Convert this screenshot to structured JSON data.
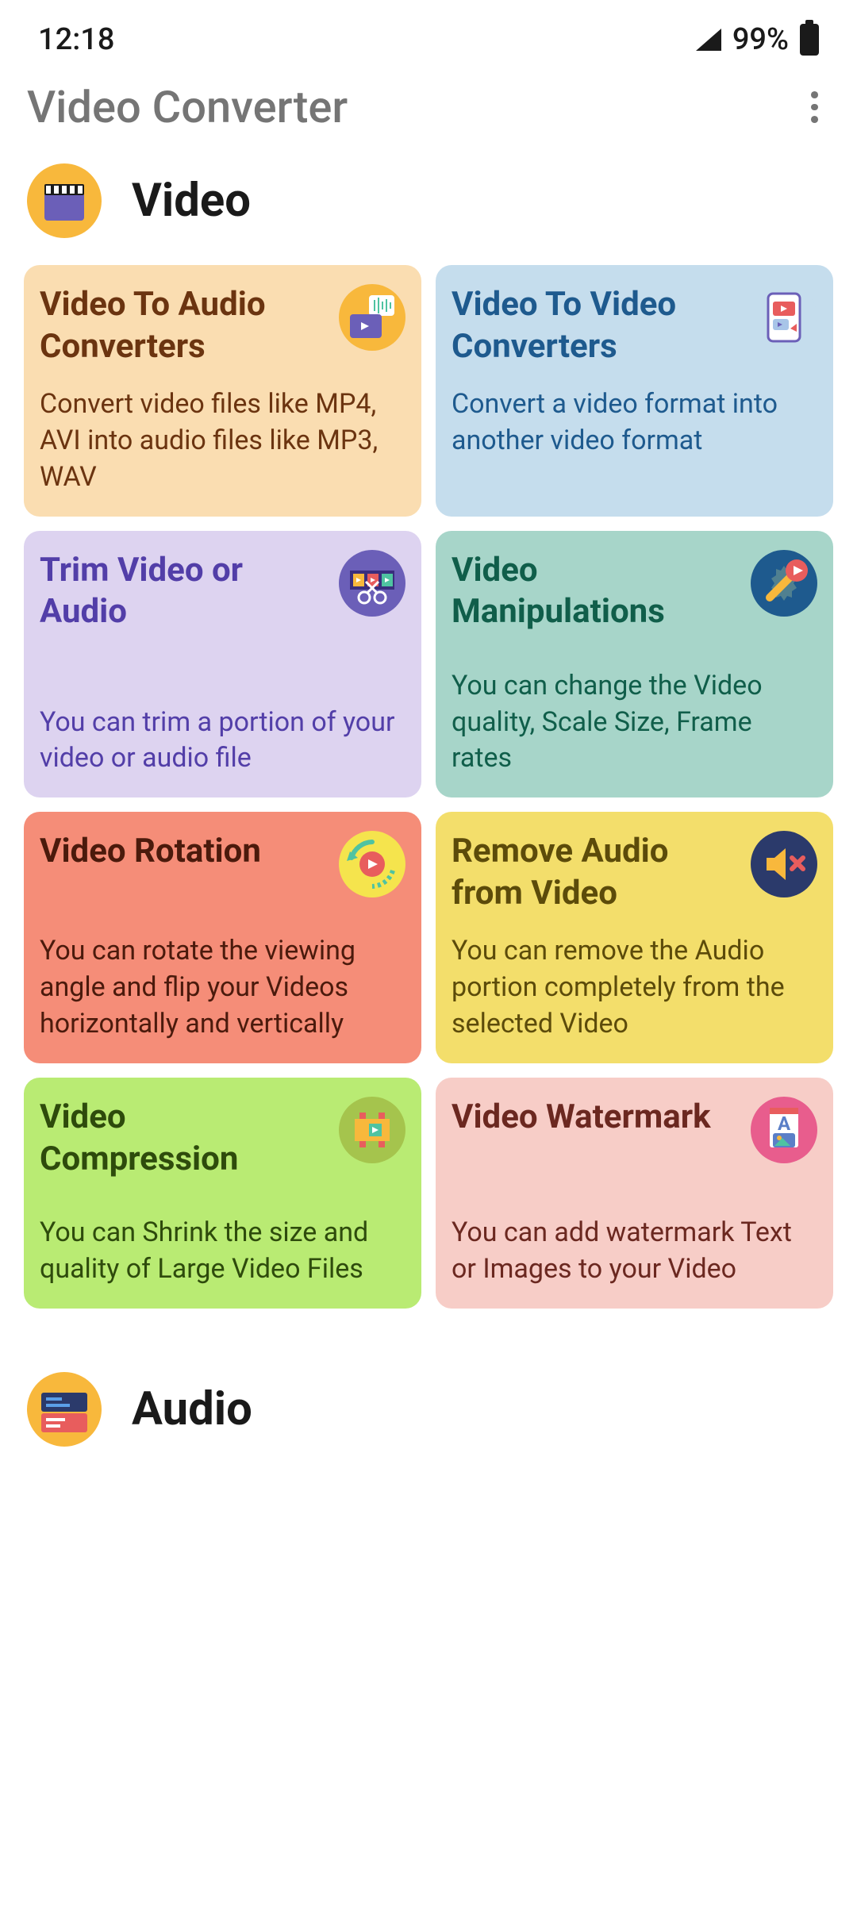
{
  "status": {
    "time": "12:18",
    "battery_pct": "99%"
  },
  "header": {
    "title": "Video Converter"
  },
  "sections": {
    "video": {
      "title": "Video"
    },
    "audio": {
      "title": "Audio"
    }
  },
  "cards": [
    {
      "title": "Video To Audio Converters",
      "desc": "Convert video files like MP4, AVI into audio files like MP3, WAV",
      "icon": "video-to-audio-icon",
      "color": "orange"
    },
    {
      "title": "Video To Video Converters",
      "desc": "Convert a video format into another video format",
      "icon": "video-to-video-icon",
      "color": "blue"
    },
    {
      "title": "Trim Video or Audio",
      "desc": "You can trim a portion of your video or audio file",
      "icon": "trim-icon",
      "color": "purple"
    },
    {
      "title": "Video Manipulations",
      "desc": "You can change the Video quality, Scale Size, Frame rates",
      "icon": "manipulation-icon",
      "color": "teal"
    },
    {
      "title": "Video Rotation",
      "desc": "You can rotate the viewing angle and flip your Videos horizontally and vertically",
      "icon": "rotation-icon",
      "color": "red"
    },
    {
      "title": "Remove Audio from Video",
      "desc": "You can remove the Audio portion completely from the selected Video",
      "icon": "remove-audio-icon",
      "color": "yellow"
    },
    {
      "title": "Video Compression",
      "desc": "You can Shrink the size and quality of Large Video Files",
      "icon": "compression-icon",
      "color": "green"
    },
    {
      "title": "Video Watermark",
      "desc": "You can add watermark Text or Images to your Video",
      "icon": "watermark-icon",
      "color": "pink"
    }
  ]
}
